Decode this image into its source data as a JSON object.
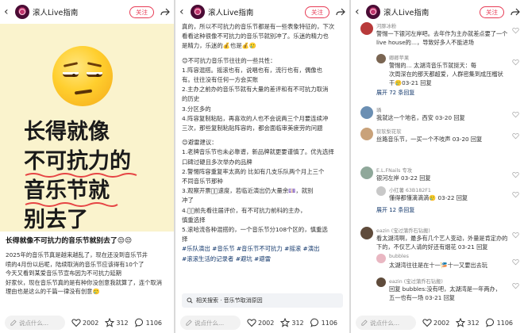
{
  "account": {
    "name": "滚人Live指南",
    "follow_label": "关注"
  },
  "cover": {
    "lines": [
      "长得就像",
      "不可抗力的",
      "音乐节就",
      "别去了"
    ],
    "emoji": "unamused-face"
  },
  "post": {
    "title": "长得就像不可抗力的音乐节就别去了😒😒",
    "caption_lines": [
      "2025年的音乐节真是越来越乱了，现在还没到音乐节井",
      "喷的4月份以后呢，陆续取消的音乐节应该得有10个了",
      "今天又看到某爱音乐节宣布因为不可抗力延期",
      "好家伙，现在音乐节真的是有种你没创意我就算了，连个取消",
      "理由也是这么的千篇一律没有创意🥲"
    ],
    "body_lines": [
      "真的，所以不可抗力的音乐节都是有一些表象特征的，下次",
      "看看这种很像不可抗力的音乐节就别冲了。乐迷的精力也",
      "是精力，乐迷的💰也是💰🥲",
      "",
      "😊不可抗力音乐节往往的一些共性：",
      "1.阵容混搭。摇滚也有，说唱也有，流行也有，偶像也",
      "有。往往没有任何一方会买账",
      "2.主办之前办的音乐节就有大量的差评和有不可抗力取消",
      "的历史",
      "3.分区多的",
      "4.阵容复制粘贴，再喜欢的人也不会说两三个月要连续冲",
      "三次，那些复制粘贴阵容的，都会面临审美疲劳的问题",
      "",
      "😊避雷建议：",
      "1.老牌音乐节也未必靠谱，新品牌就更要谨慎了。优先选择",
      "口碑过硬且多次举办的品牌",
      "2.警惕阵容重复率太高的 比如有几支乐队两个月上三个",
      "不同音乐节那种",
      "3.观察开票后🏼速度，若临近演出仍大量余💷，就别",
      "冲了",
      "4.🏼🏼前先看往届评价，有不可抗力前科的主办，",
      "慎重选择",
      "5.滚哈流各种混搭的，一个音乐节分108个区的，慎重选",
      "择"
    ],
    "tags": [
      [
        "#乐队演出",
        "#音乐节",
        "#音乐节不可抗力",
        "#摇滚",
        "#演出"
      ],
      [
        "#滚滚生活的记录者",
        "#避坑",
        "#避雷"
      ]
    ],
    "related_search": "相关搜索 · 音乐节取消原因"
  },
  "stats": {
    "comment_placeholder": "说点什么...",
    "likes": "2002",
    "favorites": "312",
    "comments": "1106"
  },
  "comments": [
    {
      "name": "河豚冰粉",
      "lines": [
        "警惕一下银河左岸吧。去年作为主办就差点要了一个",
        "live house的…，导致好多人不能进场"
      ],
      "time": "03-21 回复",
      "likes": ""
    },
    {
      "name": "卿卿苹果",
      "lines": [
        "警惕的… 太湖湾音乐节就挺天：每",
        "次周深在的那天都超爱，人群密集到成压榴状",
        "干🥲03-21 回复"
      ],
      "time": "",
      "likes": "",
      "reply": true
    },
    {
      "name": "",
      "lines": [
        "展开 72 条回复"
      ],
      "time": "",
      "likes": "",
      "expand": true
    },
    {
      "name": "璘",
      "lines": [
        "我就这一个地名，西安 03-20 回复"
      ],
      "time": "",
      "likes": ""
    },
    {
      "name": "软软梨花软",
      "lines": [
        "丝路音乐节，一买一个不吱声 03-20 回复"
      ],
      "time": "",
      "likes": ""
    },
    {
      "name": "E.L.FNails 专攻",
      "lines": [
        "银河左岸 03-22 回复"
      ],
      "time": "",
      "likes": ""
    },
    {
      "name": "小红薯 63B182F1",
      "lines": [
        "懂得都懂滴滴滴🥲 03-22 回复"
      ],
      "time": "",
      "likes": "",
      "reply": true
    },
    {
      "name": "",
      "lines": [
        "展开 12 条回复"
      ],
      "time": "",
      "likes": "",
      "expand": true
    },
    {
      "name": "eazin (宝过蒲乔石钻搬)",
      "lines": [
        "看太湖湾啊，最多有几个艺人变动，外量是肯定办的",
        "下的，不仅艺人请的好还有烟花 03-21 回复"
      ],
      "time": "",
      "likes": ""
    },
    {
      "name": "bubbles",
      "lines": [
        "太湖湾往往是在十一🎏十一又要出去玩"
      ],
      "time": "",
      "likes": "",
      "reply": true
    },
    {
      "name": "eazin (宝过蒲乔石钻搬)",
      "lines": [
        "回复 bubbles:没有吧，太湖湾是一年两办，",
        "五一也有一场 03-21 回复"
      ],
      "time": "",
      "likes": "",
      "reply": true
    }
  ]
}
